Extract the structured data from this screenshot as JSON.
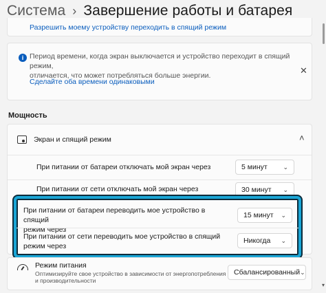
{
  "header": {
    "section": "Система",
    "chevron": "›",
    "page": "Завершение работы и батарея"
  },
  "top_link": "Разрешить моему устройству переходить в спящий режим",
  "info": {
    "icon": "info-icon",
    "text_line1": "Период времени, когда экран выключается и устройство переходит в спящий режим,",
    "text_line2": "отличается, что может потребляться больше энергии.",
    "link": "Сделайте оба времени одинаковыми",
    "close": "✕"
  },
  "section_title": "Мощность",
  "screen_sleep": {
    "title": "Экран и спящий режим",
    "expand": "˄"
  },
  "rows": [
    {
      "label": "При питании от батареи отключать мой экран через",
      "value": "5 минут"
    },
    {
      "label": "При питании от сети отключать мой экран через",
      "value": "30 минут"
    },
    {
      "label_line1": "При питании от батареи переводить мое устройство в спящий",
      "label_line2": "режим через",
      "value": "15 минут"
    },
    {
      "label_line1": "При питании от сети переводить мое устройство в спящий",
      "label_line2": "режим через",
      "value": "Никогда"
    }
  ],
  "power_mode": {
    "title": "Режим питания",
    "desc_line1": "Оптимизируйте свое устройство в зависимости от энергопотребления",
    "desc_line2": "и производительности",
    "value": "Сбалансированный"
  },
  "dropdown_arrow": "⌄",
  "colors": {
    "accent": "#0a5dbd",
    "highlight": "#1aa6d6"
  }
}
